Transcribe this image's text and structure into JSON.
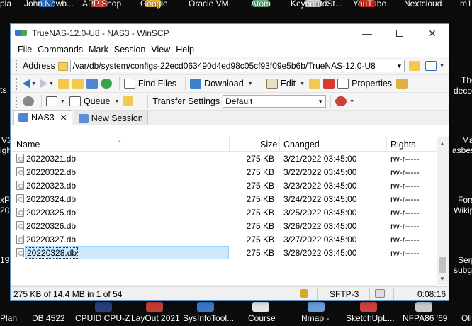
{
  "desktop": {
    "top_labels": [
      "pla",
      "John.Newb...",
      "APP Shop",
      "Google",
      "Oracle VM",
      "Atom",
      "KeyboardSt...",
      "YouTube",
      "Nextcloud",
      "m1"
    ],
    "left_labels": [
      "ts",
      "V2",
      "igh",
      "xP",
      "20...",
      "19."
    ],
    "right_labels": [
      "The",
      "deco",
      "Ma",
      "asbes",
      "Fors",
      "Wikip",
      "Serp",
      "subg",
      "Oli"
    ],
    "bottom_labels": [
      "Plan",
      "DB 4522",
      "CPUID CPU-Z",
      "LayOut 2021",
      "SysInfoTool...",
      "Course",
      "Nmap -",
      "SketchUpL...",
      "NFPA86 '69"
    ]
  },
  "window": {
    "title": "TrueNAS-12.0-U8 - NAS3 - WinSCP",
    "menu": [
      "File",
      "Commands",
      "Mark",
      "Session",
      "View",
      "Help"
    ],
    "address_label": "Address",
    "address_value": "/var/db/system/configs-22ecd063490d4ed98c05cf93f09e5b6b/TrueNAS-12.0-U8",
    "toolbar": {
      "find_files": "Find Files",
      "download": "Download",
      "edit": "Edit",
      "properties": "Properties"
    },
    "toolbar2": {
      "queue": "Queue",
      "transfer_settings_label": "Transfer Settings",
      "transfer_settings_value": "Default"
    },
    "tabs": [
      {
        "label": "NAS3",
        "active": true
      },
      {
        "label": "New Session",
        "active": false
      }
    ],
    "columns": [
      "Name",
      "Size",
      "Changed",
      "Rights"
    ],
    "files": [
      {
        "name": "20220321.db",
        "size": "275 KB",
        "changed": "3/21/2022 03:45:00",
        "rights": "rw-r-----"
      },
      {
        "name": "20220322.db",
        "size": "275 KB",
        "changed": "3/22/2022 03:45:00",
        "rights": "rw-r-----"
      },
      {
        "name": "20220323.db",
        "size": "275 KB",
        "changed": "3/23/2022 03:45:00",
        "rights": "rw-r-----"
      },
      {
        "name": "20220324.db",
        "size": "275 KB",
        "changed": "3/24/2022 03:45:00",
        "rights": "rw-r-----"
      },
      {
        "name": "20220325.db",
        "size": "275 KB",
        "changed": "3/25/2022 03:45:00",
        "rights": "rw-r-----"
      },
      {
        "name": "20220326.db",
        "size": "275 KB",
        "changed": "3/26/2022 03:45:00",
        "rights": "rw-r-----"
      },
      {
        "name": "20220327.db",
        "size": "275 KB",
        "changed": "3/27/2022 03:45:00",
        "rights": "rw-r-----"
      },
      {
        "name": "20220328.db",
        "size": "275 KB",
        "changed": "3/28/2022 03:45:00",
        "rights": "rw-r-----",
        "selected": true
      }
    ],
    "status": {
      "selection": "275 KB of 14.4 MB in 1 of 54",
      "protocol": "SFTP-3",
      "elapsed": "0:08:16"
    }
  }
}
